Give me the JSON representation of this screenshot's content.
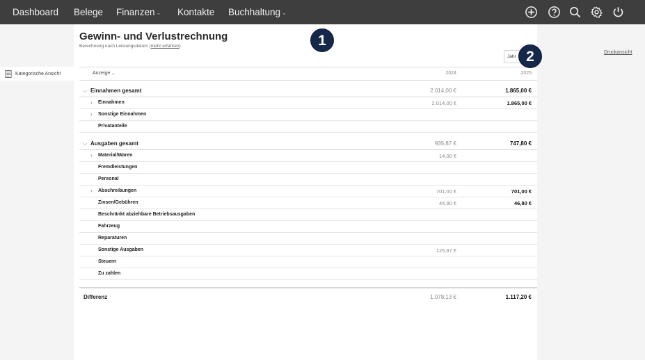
{
  "nav": {
    "items": [
      {
        "label": "Dashboard",
        "dropdown": false
      },
      {
        "label": "Belege",
        "dropdown": false
      },
      {
        "label": "Finanzen",
        "dropdown": true
      },
      {
        "label": "Kontakte",
        "dropdown": false
      },
      {
        "label": "Buchhaltung",
        "dropdown": true
      }
    ],
    "icons": [
      "plus-circle-icon",
      "help-circle-icon",
      "search-icon",
      "gear-icon",
      "power-icon"
    ]
  },
  "sidebar": {
    "items": [
      {
        "label": "Kategorische Ansicht",
        "icon": "document-icon"
      }
    ]
  },
  "page": {
    "title": "Gewinn- und Verlustrechnung",
    "subtitle": "Berechnung nach Leistungsdatum",
    "subtitle_open": "(",
    "subtitle_link": "mehr erfahren",
    "subtitle_close": ")",
    "year_select_value": "Jahr",
    "print_link": "Druckansicht"
  },
  "badges": [
    "1",
    "2"
  ],
  "table": {
    "display_label": "Anzeige",
    "years": [
      "2024",
      "2025"
    ],
    "rows": [
      {
        "name": "Einnahmen gesamt",
        "group": true,
        "expand": "down",
        "v2024": "2.014,00 €",
        "v2025": "1.865,00 €"
      },
      {
        "name": "Einnahmen",
        "group": false,
        "expand": "right",
        "v2024": "2.014,00 €",
        "v2025": "1.865,00 €"
      },
      {
        "name": "Sonstige Einnahmen",
        "group": false,
        "expand": "right",
        "v2024": "",
        "v2025": ""
      },
      {
        "name": "Privatanteile",
        "group": false,
        "expand": "",
        "v2024": "",
        "v2025": ""
      },
      {
        "name": "Ausgaben gesamt",
        "group": true,
        "expand": "down",
        "v2024": "935,87 €",
        "v2025": "747,80 €"
      },
      {
        "name": "Material/Waren",
        "group": false,
        "expand": "right",
        "v2024": "14,00 €",
        "v2025": ""
      },
      {
        "name": "Fremdleistungen",
        "group": false,
        "expand": "",
        "v2024": "",
        "v2025": ""
      },
      {
        "name": "Personal",
        "group": false,
        "expand": "",
        "v2024": "",
        "v2025": ""
      },
      {
        "name": "Abschreibungen",
        "group": false,
        "expand": "right",
        "v2024": "701,00 €",
        "v2025": "701,00 €"
      },
      {
        "name": "Zinsen/Gebühren",
        "group": false,
        "expand": "",
        "v2024": "44,90 €",
        "v2025": "46,80 €"
      },
      {
        "name": "Beschränkt abziehbare Betriebsausgaben",
        "group": false,
        "expand": "",
        "v2024": "",
        "v2025": ""
      },
      {
        "name": "Fahrzeug",
        "group": false,
        "expand": "",
        "v2024": "",
        "v2025": ""
      },
      {
        "name": "Reparaturen",
        "group": false,
        "expand": "",
        "v2024": "",
        "v2025": ""
      },
      {
        "name": "Sonstige Ausgaben",
        "group": false,
        "expand": "",
        "v2024": "125,97 €",
        "v2025": ""
      },
      {
        "name": "Steuern",
        "group": false,
        "expand": "",
        "v2024": "",
        "v2025": ""
      },
      {
        "name": "Zu zahlen",
        "group": false,
        "expand": "",
        "v2024": "",
        "v2025": ""
      }
    ],
    "total": {
      "name": "Differenz",
      "v2024": "1.078,13 €",
      "v2025": "1.117,20 €"
    }
  },
  "colors": {
    "topbar": "#3e3e3e",
    "badge": "#16284a"
  }
}
